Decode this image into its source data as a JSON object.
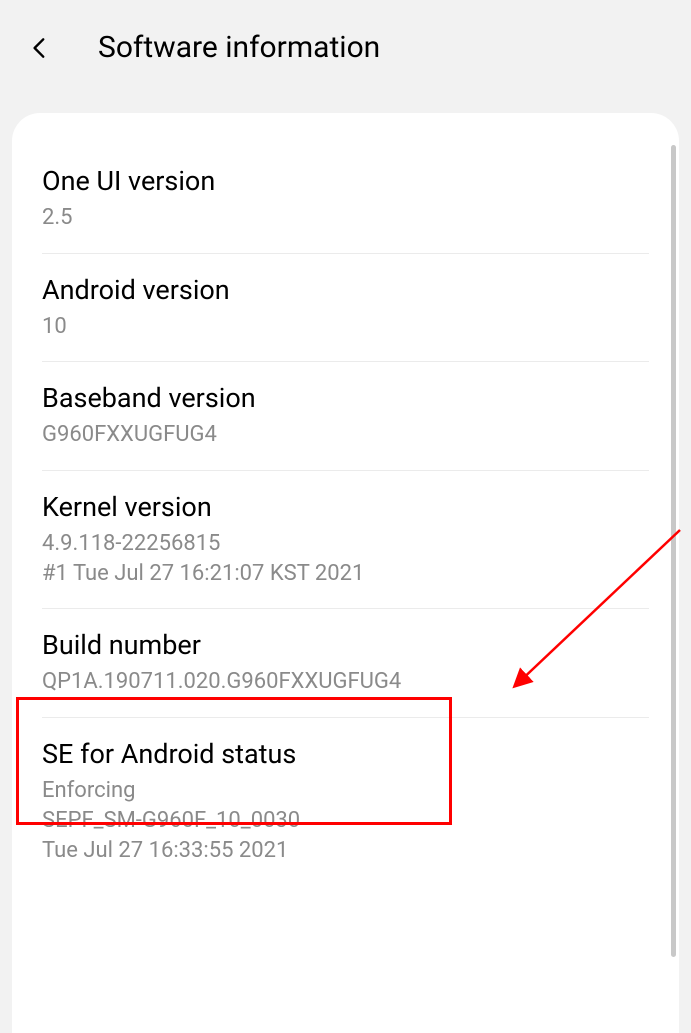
{
  "header": {
    "title": "Software information"
  },
  "items": [
    {
      "title": "One UI version",
      "value": "2.5"
    },
    {
      "title": "Android version",
      "value": "10"
    },
    {
      "title": "Baseband version",
      "value": "G960FXXUGFUG4"
    },
    {
      "title": "Kernel version",
      "value": "4.9.118-22256815\n#1 Tue Jul 27 16:21:07 KST 2021"
    },
    {
      "title": "Build number",
      "value": "QP1A.190711.020.G960FXXUGFUG4"
    },
    {
      "title": "SE for Android status",
      "value": "Enforcing\nSEPF_SM-G960F_10_0030\nTue Jul 27 16:33:55 2021"
    }
  ],
  "annotation": {
    "highlight_color": "#ff0000"
  }
}
